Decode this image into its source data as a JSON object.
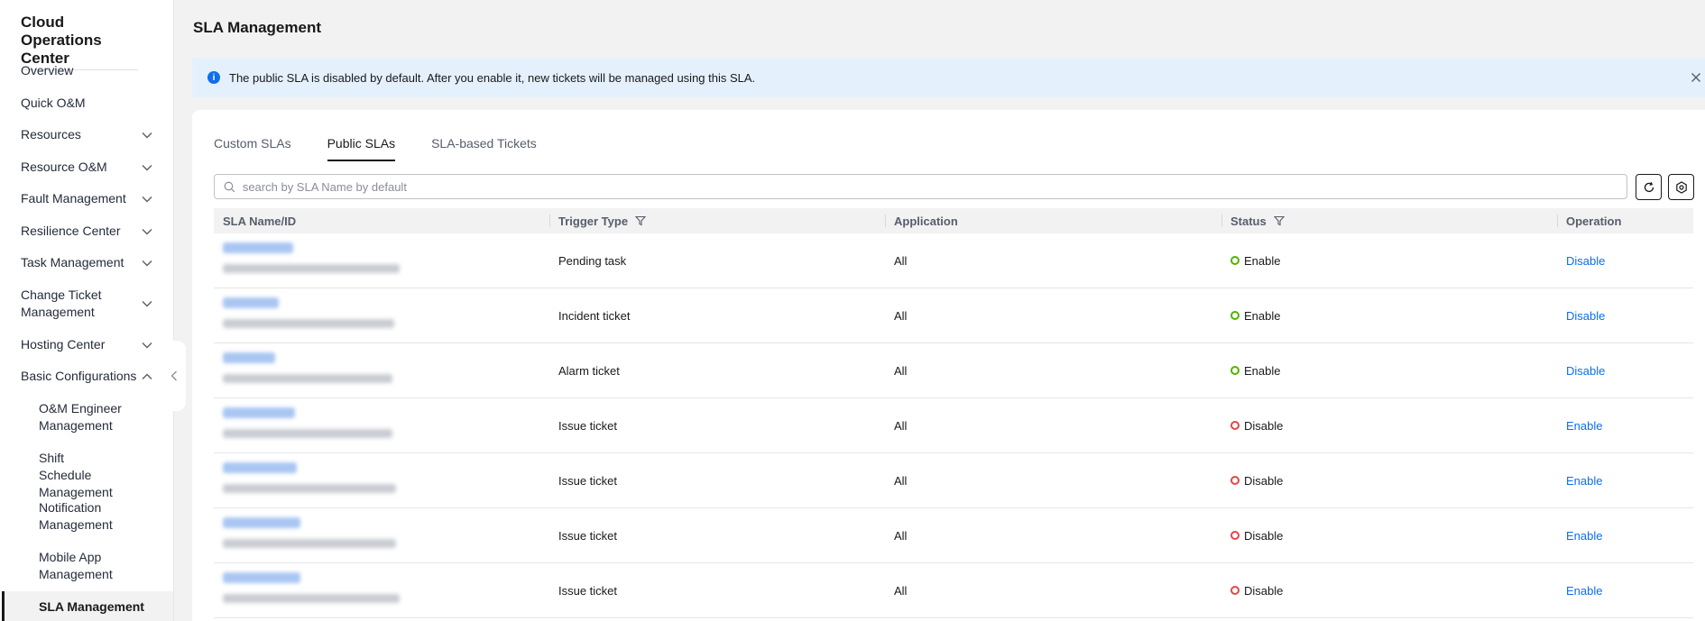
{
  "sidebar": {
    "title": "Cloud Operations Center",
    "items": [
      {
        "label": "Overview"
      },
      {
        "label": "Quick O&M"
      },
      {
        "label": "Resources"
      },
      {
        "label": "Resource O&M"
      },
      {
        "label": "Fault Management"
      },
      {
        "label": "Resilience Center"
      },
      {
        "label": "Task Management"
      },
      {
        "label": "Change Ticket Management"
      },
      {
        "label": "Hosting Center"
      },
      {
        "label": "Basic Configurations"
      }
    ],
    "subitems": [
      {
        "label": "O&M Engineer Management"
      },
      {
        "label": "Shift Schedule Management"
      },
      {
        "label": "Notification Management"
      },
      {
        "label": "Mobile App Management"
      }
    ],
    "active_item": "SLA Management"
  },
  "header": {
    "title": "SLA Management"
  },
  "notice": {
    "text": "The public SLA is disabled by default. After you enable it, new tickets will be managed using this SLA."
  },
  "tabs": [
    {
      "label": "Custom SLAs"
    },
    {
      "label": "Public SLAs"
    },
    {
      "label": "SLA-based Tickets"
    }
  ],
  "active_tab": "Public SLAs",
  "search": {
    "placeholder": "search by SLA Name by default",
    "value": ""
  },
  "table": {
    "columns": [
      "SLA Name/ID",
      "Trigger Type",
      "Application",
      "Status",
      "Operation"
    ],
    "rows": [
      {
        "trigger": "Pending task",
        "application": "All",
        "status": "Enable",
        "operation": "Disable"
      },
      {
        "trigger": "Incident ticket",
        "application": "All",
        "status": "Enable",
        "operation": "Disable"
      },
      {
        "trigger": "Alarm ticket",
        "application": "All",
        "status": "Enable",
        "operation": "Disable"
      },
      {
        "trigger": "Issue ticket",
        "application": "All",
        "status": "Disable",
        "operation": "Enable"
      },
      {
        "trigger": "Issue ticket",
        "application": "All",
        "status": "Disable",
        "operation": "Enable"
      },
      {
        "trigger": "Issue ticket",
        "application": "All",
        "status": "Disable",
        "operation": "Enable"
      },
      {
        "trigger": "Issue ticket",
        "application": "All",
        "status": "Disable",
        "operation": "Enable"
      }
    ]
  },
  "colors": {
    "enabled": "#50b300",
    "disabled": "#e54545",
    "link": "#0d6ef0"
  }
}
